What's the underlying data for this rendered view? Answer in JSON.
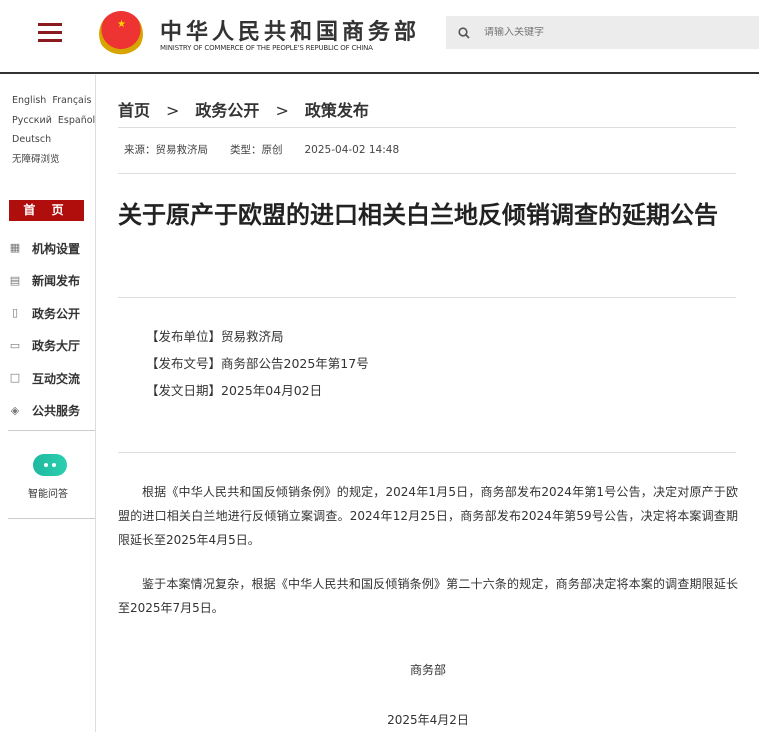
{
  "header": {
    "title": "中华人民共和国商务部",
    "subtitle": "MINISTRY OF COMMERCE OF THE PEOPLE'S REPUBLIC OF CHINA",
    "search_placeholder": "请输入关键字"
  },
  "sidebar": {
    "languages": [
      "English",
      "Français",
      "Русский",
      "Español",
      "Deutsch",
      "无障碍浏览"
    ],
    "home": "首 页",
    "items": [
      {
        "label": "机构设置",
        "icon": "grid-icon"
      },
      {
        "label": "新闻发布",
        "icon": "news-icon"
      },
      {
        "label": "政务公开",
        "icon": "document-icon"
      },
      {
        "label": "政务大厅",
        "icon": "monitor-icon"
      },
      {
        "label": "互动交流",
        "icon": "chat-icon"
      },
      {
        "label": "公共服务",
        "icon": "service-icon"
      }
    ],
    "ai_label": "智能问答"
  },
  "breadcrumb": [
    "首页",
    "政务公开",
    "政策发布"
  ],
  "meta": {
    "source": "来源：贸易救济局",
    "type": "类型：原创",
    "datetime": "2025-04-02 14:48"
  },
  "article": {
    "title": "关于原产于欧盟的进口相关白兰地反倾销调查的延期公告",
    "info": [
      "【发布单位】贸易救济局",
      "【发布文号】商务部公告2025年第17号",
      "【发文日期】2025年04月02日"
    ],
    "paragraphs": [
      "根据《中华人民共和国反倾销条例》的规定，2024年1月5日，商务部发布2024年第1号公告，决定对原产于欧盟的进口相关白兰地进行反倾销立案调查。2024年12月25日，商务部发布2024年第59号公告，决定将本案调查期限延长至2025年4月5日。",
      "鉴于本案情况复杂，根据《中华人民共和国反倾销条例》第二十六条的规定，商务部决定将本案的调查期限延长至2025年7月5日。"
    ],
    "signature": "商务部",
    "sign_date": "2025年4月2日"
  }
}
